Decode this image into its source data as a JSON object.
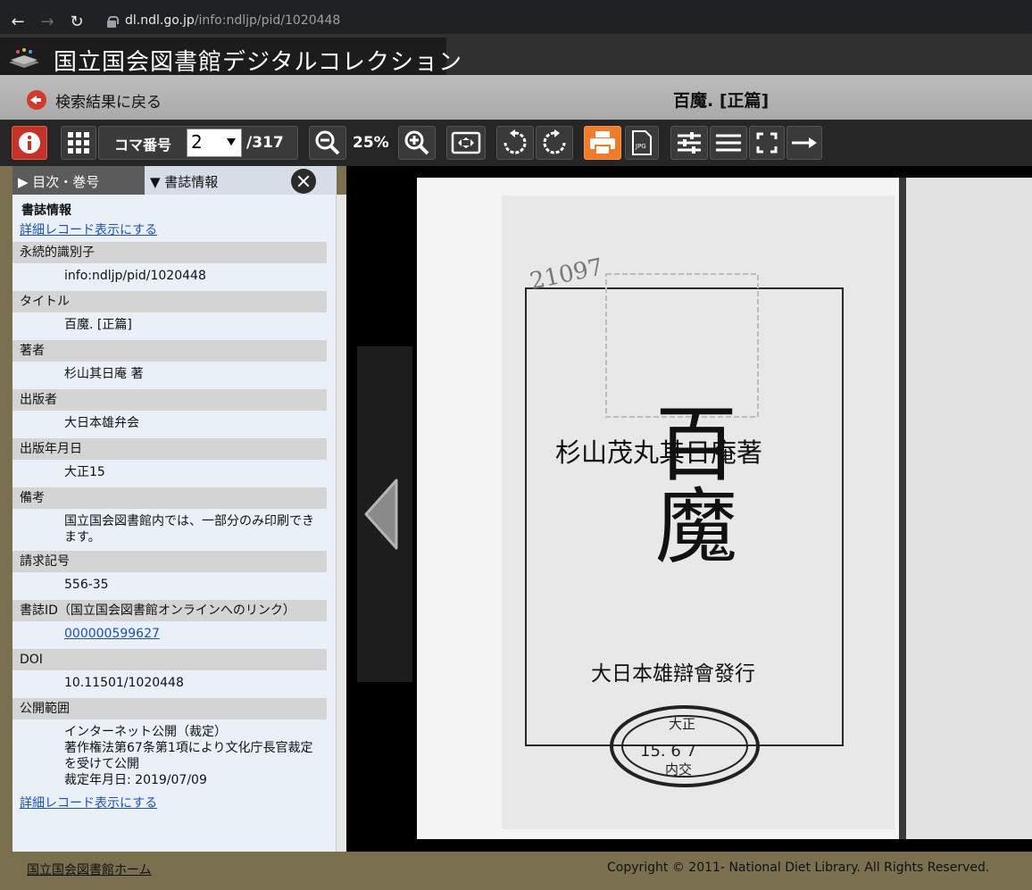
{
  "browser": {
    "url_host": "dl.ndl.go.jp",
    "url_path": "/info:ndljp/pid/1020448"
  },
  "site": {
    "title": "国立国会図書館デジタルコレクション"
  },
  "titlebar": {
    "back_label": "検索結果に戻る",
    "book_title": "百魔. [正篇]"
  },
  "toolbar": {
    "frame_label": "コマ番号",
    "frame_value": "2",
    "frame_total": "/317",
    "zoom": "25%"
  },
  "panel": {
    "tab_toc": "▶ 目次・巻号",
    "tab_biblio": "▼ 書誌情報",
    "heading": "書誌情報",
    "detail_link": "詳細レコード表示にする",
    "fields": [
      {
        "label": "永続的識別子",
        "value": "info:ndljp/pid/1020448"
      },
      {
        "label": "タイトル",
        "value": "百魔. [正篇]"
      },
      {
        "label": "著者",
        "value": "杉山其日庵 著"
      },
      {
        "label": "出版者",
        "value": "大日本雄弁会"
      },
      {
        "label": "出版年月日",
        "value": "大正15"
      },
      {
        "label": "備考",
        "value": "国立国会図書館内では、一部分のみ印刷できます。"
      },
      {
        "label": "請求記号",
        "value": "556-35"
      },
      {
        "label": "書誌ID（国立国会図書館オンラインへのリンク）",
        "value": "000000599627"
      },
      {
        "label": "DOI",
        "value": "10.11501/1020448"
      },
      {
        "label": "公開範囲",
        "value": "インターネット公開（裁定）",
        "value2": "著作権法第67条第1項により文化庁長官裁定を受けて公開",
        "value3": "裁定年月日: 2019/07/09"
      }
    ],
    "detail_link_bottom": "詳細レコード表示にする"
  },
  "page_image": {
    "title_chars": "百魔",
    "author_line": "杉山茂丸其日庵著",
    "publisher_line": "大日本雄辯會發行",
    "stamp_top": "大正",
    "stamp_mid": "15. 6 7",
    "stamp_bottom": "内交",
    "handwritten": "21097"
  },
  "footer": {
    "home_link": "国立国会図書館ホーム",
    "copyright": "Copyright © 2011- National Diet Library. All Rights Reserved."
  }
}
